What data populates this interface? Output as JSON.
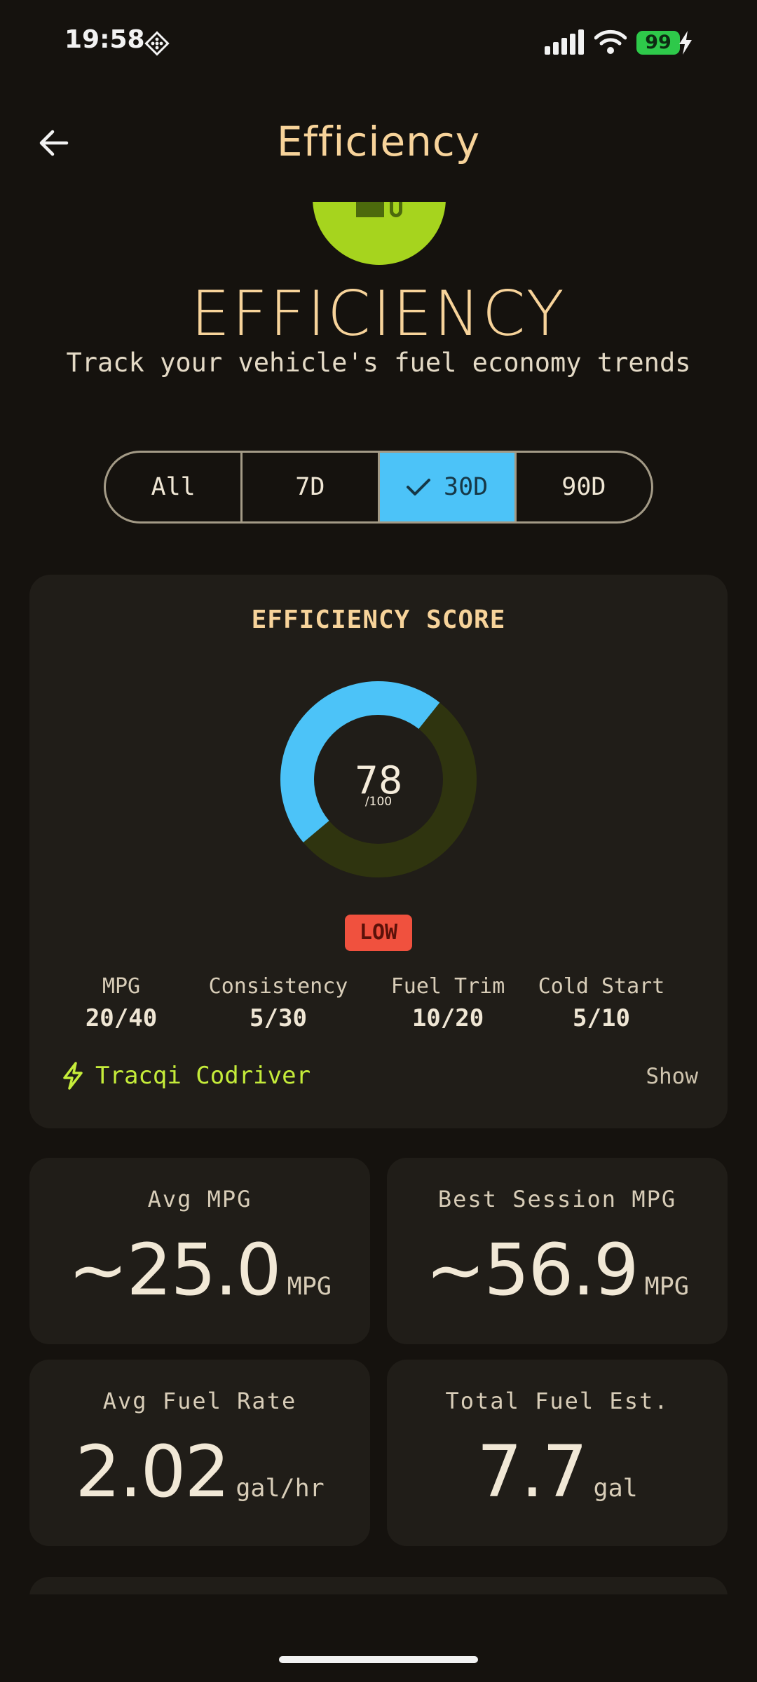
{
  "status_bar": {
    "time": "19:58",
    "battery": "99"
  },
  "app_bar": {
    "title": "Efficiency"
  },
  "hero": {
    "title": "EFFICIENCY",
    "subtitle": "Track your vehicle's fuel economy trends"
  },
  "range_filter": {
    "options": [
      "All",
      "7D",
      "30D",
      "90D"
    ],
    "selected": "30D"
  },
  "score_card": {
    "title": "EFFICIENCY SCORE",
    "score": "78",
    "score_max": "/100",
    "score_fraction": 0.78,
    "level": "LOW",
    "metrics": [
      {
        "label": "MPG",
        "value": "20/40"
      },
      {
        "label": "Consistency",
        "value": "5/30"
      },
      {
        "label": "Fuel Trim",
        "value": "10/20"
      },
      {
        "label": "Cold Start",
        "value": "5/10"
      }
    ],
    "codriver_label": "Tracqi Codriver",
    "codriver_action": "Show"
  },
  "stats": [
    {
      "label": "Avg MPG",
      "value": "~25.0",
      "unit": "MPG"
    },
    {
      "label": "Best Session MPG",
      "value": "~56.9",
      "unit": "MPG"
    },
    {
      "label": "Avg Fuel Rate",
      "value": "2.02",
      "unit": "gal/hr"
    },
    {
      "label": "Total Fuel Est.",
      "value": "7.7",
      "unit": "gal"
    }
  ],
  "colors": {
    "accent": "#f7d39a",
    "selected": "#4cc3f8",
    "donut_track": "#2f340f",
    "badge_low": "#f0513e",
    "codriver": "#c5ec3a",
    "hero_disc": "#a6d41e"
  }
}
